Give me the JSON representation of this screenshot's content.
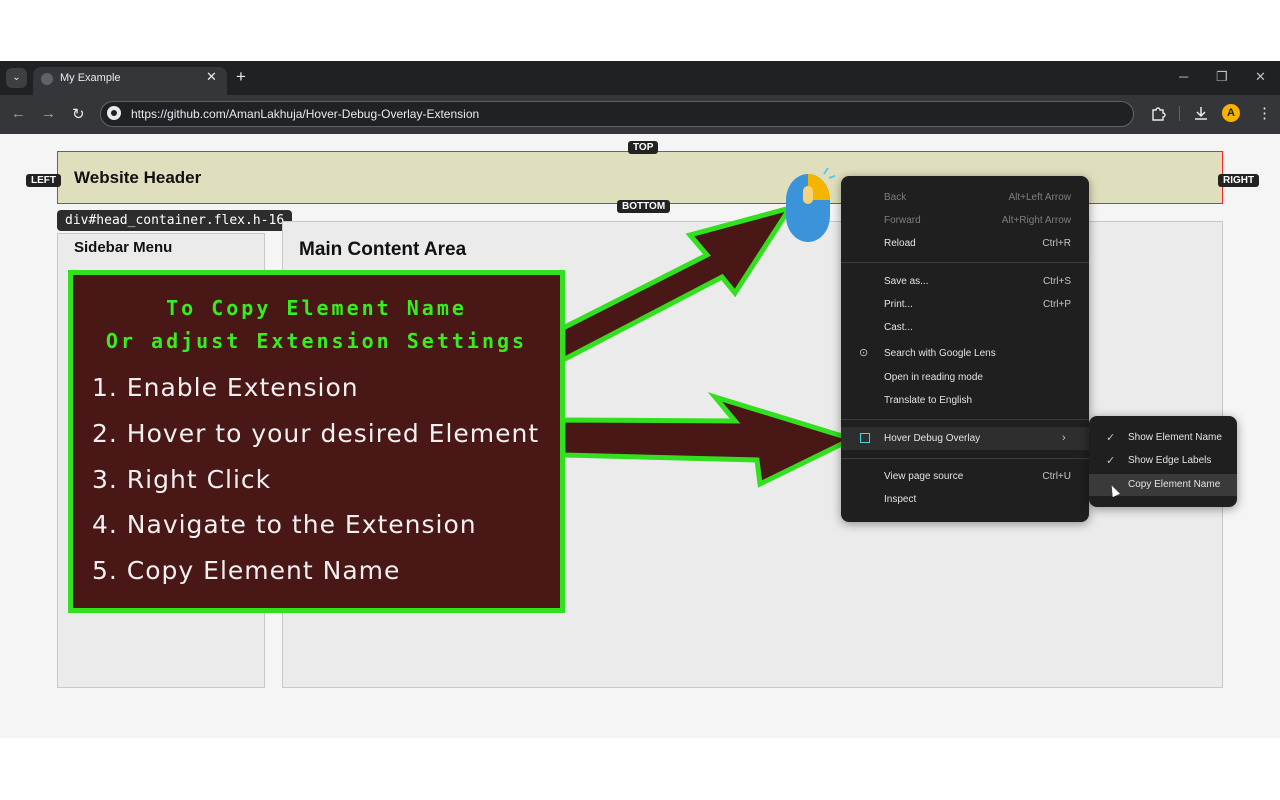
{
  "browser": {
    "tab_title": "My Example",
    "tab_close": "✕",
    "new_tab": "+",
    "url": "https://github.com/AmanLakhuja/Hover-Debug-Overlay-Extension",
    "minimize": "─",
    "restore": "❐",
    "close": "✕",
    "back": "←",
    "forward": "→",
    "reload": "↻",
    "profile_initial": "A"
  },
  "page": {
    "header_title": "Website Header",
    "edge_labels": {
      "top": "TOP",
      "bottom": "BOTTOM",
      "left": "LEFT",
      "right": "RIGHT"
    },
    "element_tooltip": "div#head_container.flex.h-16",
    "sidebar_title": "Sidebar Menu",
    "main_title": "Main Content Area"
  },
  "instructions": {
    "heading_line1": "To Copy Element Name",
    "heading_line2": "Or adjust Extension Settings",
    "steps": [
      "1. Enable Extension",
      "2. Hover to your desired Element",
      "3. Right Click",
      "4. Navigate to the Extension",
      "5. Copy Element Name"
    ]
  },
  "context_menu": {
    "items": [
      {
        "label": "Back",
        "shortcut": "Alt+Left Arrow"
      },
      {
        "label": "Forward",
        "shortcut": "Alt+Right Arrow"
      },
      {
        "label": "Reload",
        "shortcut": "Ctrl+R"
      },
      {
        "label": "Save as...",
        "shortcut": "Ctrl+S"
      },
      {
        "label": "Print...",
        "shortcut": "Ctrl+P"
      },
      {
        "label": "Cast..."
      },
      {
        "label": "Search with Google Lens"
      },
      {
        "label": "Open in reading mode"
      },
      {
        "label": "Translate to English"
      },
      {
        "label": "Hover Debug Overlay"
      },
      {
        "label": "View page source",
        "shortcut": "Ctrl+U"
      },
      {
        "label": "Inspect"
      }
    ],
    "submenu": [
      {
        "label": "Show Element Name",
        "checked": true
      },
      {
        "label": "Show Edge Labels",
        "checked": true
      },
      {
        "label": "Copy Element Name",
        "checked": false
      }
    ]
  },
  "colors": {
    "highlight_border": "#ff2020",
    "instruction_green": "#33e01f",
    "instruction_bg": "#4a1717",
    "arrow_fill": "#4a1717"
  }
}
